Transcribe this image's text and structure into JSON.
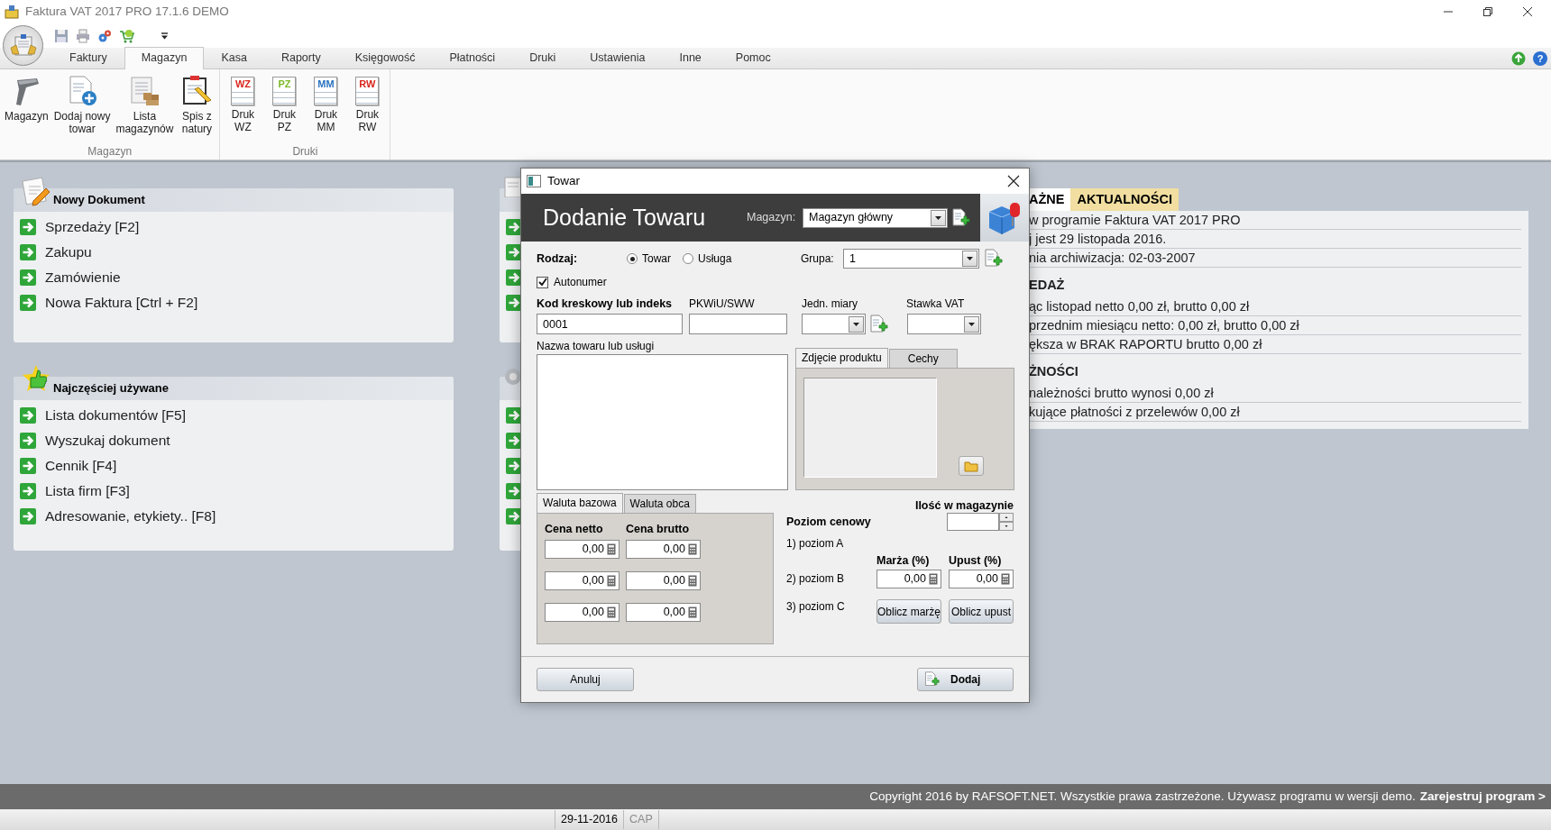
{
  "window": {
    "title": "Faktura VAT 2017 PRO 17.1.6 DEMO"
  },
  "ribbon": {
    "tabs": [
      {
        "label": "Faktury",
        "selected": false
      },
      {
        "label": "Magazyn",
        "selected": true
      },
      {
        "label": "Kasa",
        "selected": false
      },
      {
        "label": "Raporty",
        "selected": false
      },
      {
        "label": "Księgowość",
        "selected": false
      },
      {
        "label": "Płatności",
        "selected": false
      },
      {
        "label": "Druki",
        "selected": false
      },
      {
        "label": "Ustawienia",
        "selected": false
      },
      {
        "label": "Inne",
        "selected": false
      },
      {
        "label": "Pomoc",
        "selected": false
      }
    ],
    "help_glyph": "?",
    "groups": [
      {
        "label": "Magazyn",
        "buttons": [
          {
            "label": "Magazyn"
          },
          {
            "label": "Dodaj nowy\ntowar"
          },
          {
            "label": "Lista\nmagazynów"
          },
          {
            "label": "Spis z\nnatury"
          }
        ]
      },
      {
        "label": "Druki",
        "buttons": [
          {
            "label": "Druk\nWZ",
            "icon_letters": "WZ",
            "color": "#d8261c"
          },
          {
            "label": "Druk\nPZ",
            "icon_letters": "PZ",
            "color": "#7cb82a"
          },
          {
            "label": "Druk\nMM",
            "icon_letters": "MM",
            "color": "#2a73c0"
          },
          {
            "label": "Druk\nRW",
            "icon_letters": "RW",
            "color": "#d8261c"
          }
        ]
      }
    ]
  },
  "start_panels": [
    {
      "title": "Nowy Dokument",
      "items": [
        "Sprzedaży [F2]",
        "Zakupu",
        "Zamówienie",
        "Nowa Faktura [Ctrl + F2]"
      ]
    },
    {
      "title": "Najczęściej używane",
      "items": [
        "Lista dokumentów [F5]",
        "Wyszukaj dokument",
        "Cennik [F4]",
        "Lista firm [F3]",
        "Adresowanie, etykiety.. [F8]"
      ]
    }
  ],
  "info_panel": {
    "tabs": [
      {
        "label": "AŻNE",
        "selected": true
      },
      {
        "label": "AKTUALNOŚCI",
        "selected": false
      }
    ],
    "lines": [
      {
        "kind": "text",
        "text": "w programie Faktura VAT 2017 PRO"
      },
      {
        "kind": "text",
        "text": "j jest 29 listopada 2016."
      },
      {
        "kind": "text",
        "text": "nia archiwizacja: 02-03-2007"
      },
      {
        "kind": "heading",
        "text": "EDAŻ"
      },
      {
        "kind": "text",
        "text": "ąc listopad netto 0,00 zł, brutto 0,00 zł"
      },
      {
        "kind": "text",
        "text": "przednim miesiącu netto: 0,00 zł, brutto 0,00 zł"
      },
      {
        "kind": "text",
        "text": "ększa w BRAK RAPORTU brutto 0,00 zł"
      },
      {
        "kind": "heading",
        "text": "ŻNOŚCI"
      },
      {
        "kind": "text",
        "text": "należności brutto wynosi 0,00 zł"
      },
      {
        "kind": "text",
        "text": "kujące płatności z przelewów 0,00 zł"
      }
    ]
  },
  "footer": {
    "copyright": "Copyright 2016 by RAFSOFT.NET. Wszystkie prawa zastrzeżone. Używasz programu w wersji demo.",
    "register_link": "Zarejestruj program >"
  },
  "status_bar": {
    "date": "29-11-2016",
    "caps": {
      "label": "CAP",
      "on": false
    }
  },
  "dialog": {
    "title": "Towar",
    "heading": "Dodanie Towaru",
    "warehouse": {
      "label": "Magazyn:",
      "value": "Magazyn główny"
    },
    "kind": {
      "label": "Rodzaj:",
      "options": [
        {
          "label": "Towar",
          "selected": true
        },
        {
          "label": "Usługa",
          "selected": false
        }
      ]
    },
    "group": {
      "label": "Grupa:",
      "value": "1"
    },
    "autonumber": {
      "label": "Autonumer",
      "checked": true
    },
    "barcode": {
      "label": "Kod kreskowy lub indeks",
      "value": "0001"
    },
    "pkwiu": {
      "label": "PKWiU/SWW"
    },
    "unit": {
      "label": "Jedn. miary"
    },
    "vat": {
      "label": "Stawka VAT"
    },
    "name": {
      "label": "Nazwa towaru lub usługi"
    },
    "side_tabs": [
      {
        "label": "Zdjęcie produktu",
        "selected": true
      },
      {
        "label": "Cechy",
        "selected": false
      }
    ],
    "currency_tabs": [
      {
        "label": "Waluta bazowa",
        "selected": true
      },
      {
        "label": "Waluta obca",
        "selected": false
      }
    ],
    "price_headers": [
      "Cena netto",
      "Cena brutto"
    ],
    "prices": [
      {
        "net": "0,00",
        "gross": "0,00"
      },
      {
        "net": "0,00",
        "gross": "0,00"
      },
      {
        "net": "0,00",
        "gross": "0,00"
      }
    ],
    "stock": {
      "label": "Ilość w magazynie"
    },
    "price_level": {
      "label": "Poziom cenowy",
      "levels": [
        "1) poziom A",
        "2) poziom B",
        "3) poziom C"
      ]
    },
    "markup": {
      "label": "Marża (%)",
      "value": "0,00",
      "button": "Oblicz marżę"
    },
    "discount": {
      "label": "Upust (%)",
      "value": "0,00",
      "button": "Oblicz upust"
    },
    "cancel": "Anuluj",
    "add": "Dodaj"
  }
}
